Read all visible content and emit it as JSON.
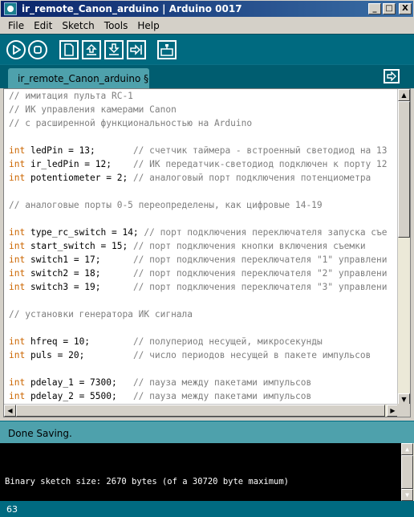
{
  "window": {
    "title": "ir_remote_Canon_arduino | Arduino 0017",
    "controls": {
      "minimize": "_",
      "maximize": "□",
      "close": "X"
    }
  },
  "menu": [
    "File",
    "Edit",
    "Sketch",
    "Tools",
    "Help"
  ],
  "toolbar": {
    "buttons": [
      "verify-icon",
      "stop-icon",
      "new-icon",
      "open-icon",
      "save-icon",
      "upload-icon",
      "serial-monitor-icon"
    ],
    "accent": "#006a80"
  },
  "tabs": [
    {
      "label": "ir_remote_Canon_arduino §"
    }
  ],
  "editor": {
    "lines": [
      [
        {
          "t": "// имитация пульта RC-1",
          "c": "cm"
        }
      ],
      [
        {
          "t": "// ИК управления камерами Canon",
          "c": "cm"
        }
      ],
      [
        {
          "t": "// с расширенной функциональностью на Arduino",
          "c": "cm"
        }
      ],
      [],
      [
        {
          "t": "int",
          "c": "kw"
        },
        {
          "t": " ledPin = 13;       ",
          "c": ""
        },
        {
          "t": "// счетчик таймера - встроенный светодиод на 13",
          "c": "cm"
        }
      ],
      [
        {
          "t": "int",
          "c": "kw"
        },
        {
          "t": " ir_ledPin = 12;    ",
          "c": ""
        },
        {
          "t": "// ИК передатчик-светодиод подключен к порту 12",
          "c": "cm"
        }
      ],
      [
        {
          "t": "int",
          "c": "kw"
        },
        {
          "t": " potentiometer = 2; ",
          "c": ""
        },
        {
          "t": "// аналоговый порт подключения потенциометра",
          "c": "cm"
        }
      ],
      [],
      [
        {
          "t": "// аналоговые порты 0-5 переопределены, как цифровые 14-19",
          "c": "cm"
        }
      ],
      [],
      [
        {
          "t": "int",
          "c": "kw"
        },
        {
          "t": " type_rc_switch = 14; ",
          "c": ""
        },
        {
          "t": "// порт подключения переключателя запуска съе",
          "c": "cm"
        }
      ],
      [
        {
          "t": "int",
          "c": "kw"
        },
        {
          "t": " start_switch = 15; ",
          "c": ""
        },
        {
          "t": "// порт подключения кнопки включения съемки",
          "c": "cm"
        }
      ],
      [
        {
          "t": "int",
          "c": "kw"
        },
        {
          "t": " switch1 = 17;      ",
          "c": ""
        },
        {
          "t": "// порт подключения переключателя \"1\" управлени",
          "c": "cm"
        }
      ],
      [
        {
          "t": "int",
          "c": "kw"
        },
        {
          "t": " switch2 = 18;      ",
          "c": ""
        },
        {
          "t": "// порт подключения переключателя \"2\" управлени",
          "c": "cm"
        }
      ],
      [
        {
          "t": "int",
          "c": "kw"
        },
        {
          "t": " switch3 = 19;      ",
          "c": ""
        },
        {
          "t": "// порт подключения переключателя \"3\" управлени",
          "c": "cm"
        }
      ],
      [],
      [
        {
          "t": "// установки генератора ИК сигнала",
          "c": "cm"
        }
      ],
      [],
      [
        {
          "t": "int",
          "c": "kw"
        },
        {
          "t": " hfreq = 10;        ",
          "c": ""
        },
        {
          "t": "// полупериод несущей, микросекунды",
          "c": "cm"
        }
      ],
      [
        {
          "t": "int",
          "c": "kw"
        },
        {
          "t": " puls = 20;         ",
          "c": ""
        },
        {
          "t": "// число периодов несущей в пакете импульсов",
          "c": "cm"
        }
      ],
      [],
      [
        {
          "t": "int",
          "c": "kw"
        },
        {
          "t": " pdelay_1 = 7300;   ",
          "c": ""
        },
        {
          "t": "// пауза между пакетами импульсов",
          "c": "cm"
        }
      ],
      [
        {
          "t": "int",
          "c": "kw"
        },
        {
          "t": " pdelay_2 = 5500;   ",
          "c": ""
        },
        {
          "t": "// пауза между пакетами импульсов",
          "c": "cm"
        }
      ]
    ]
  },
  "status": {
    "message": "Done Saving."
  },
  "console": {
    "text": "Binary sketch size: 2670 bytes (of a 30720 byte maximum)"
  },
  "linebar": {
    "line_number": "63"
  }
}
